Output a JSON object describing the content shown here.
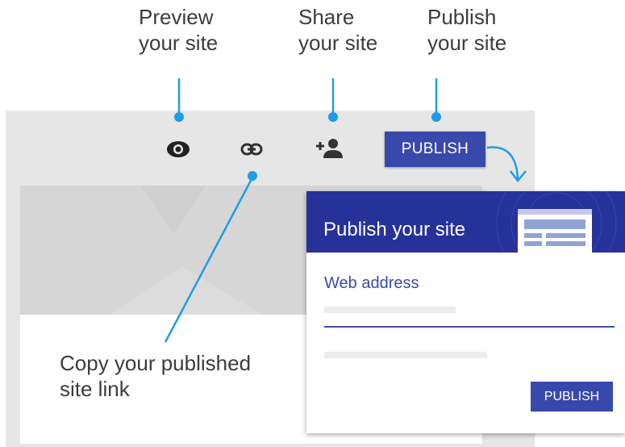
{
  "callouts": {
    "preview": "Preview\nyour site",
    "share": "Share\nyour site",
    "publish": "Publish\nyour site",
    "copy_link": "Copy your published\nsite link"
  },
  "toolbar": {
    "publish_label": "PUBLISH",
    "icons": [
      "eye-icon",
      "link-icon",
      "add-person-icon"
    ]
  },
  "dialog": {
    "title": "Publish your site",
    "field_label": "Web address",
    "publish_label": "PUBLISH"
  },
  "colors": {
    "accent": "#3949ab",
    "header": "#26329a",
    "callout_line": "#1e9ce8",
    "canvas": "#e6e6e6"
  }
}
